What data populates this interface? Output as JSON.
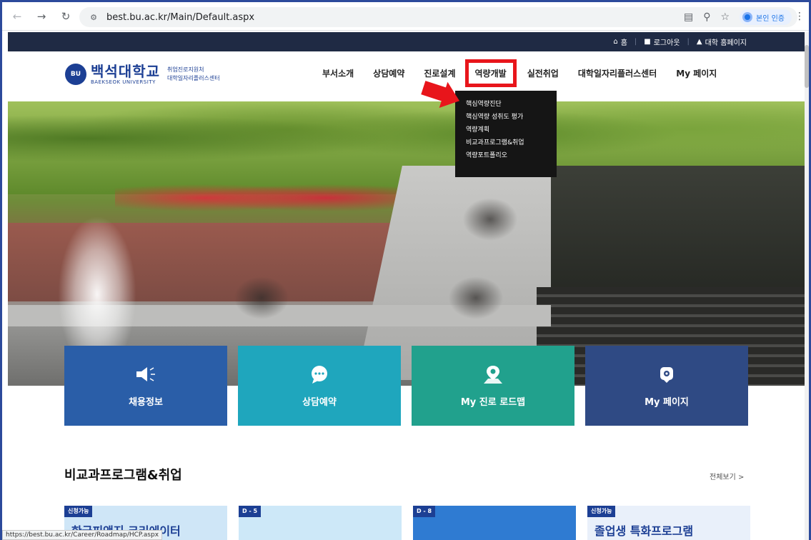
{
  "browser": {
    "url": "best.bu.ac.kr/Main/Default.aspx",
    "verify_label": "본인 인증",
    "status_url": "https://best.bu.ac.kr/Career/Roadmap/HCP.aspx"
  },
  "util_bar": {
    "home": "홈",
    "logout": "로그아웃",
    "univ_home": "대학 홈페이지"
  },
  "logo": {
    "mark": "BU",
    "name_kr": "백석대학교",
    "name_en": "BAEKSEOK UNIVERSITY",
    "sub1": "취업진로지원처",
    "sub2": "대학일자리플러스센터"
  },
  "gnb": [
    "부서소개",
    "상담예약",
    "진로설계",
    "역량개발",
    "실전취업",
    "대학일자리플러스센터",
    "My 페이지"
  ],
  "dropdown": [
    "핵심역량진단",
    "핵심역량 성취도 평가",
    "역량계획",
    "비교과프로그램&취업",
    "역량포트폴리오"
  ],
  "tiles": [
    {
      "label": "채용정보",
      "color": "#2a5ea8",
      "icon": "megaphone-icon"
    },
    {
      "label": "상담예약",
      "color": "#1fa6bd",
      "icon": "chat-bubble-icon"
    },
    {
      "label": "My 진로 로드맵",
      "color": "#21a18d",
      "icon": "map-pin-icon"
    },
    {
      "label": "My 페이지",
      "color": "#2f4a84",
      "icon": "gear-badge-icon"
    }
  ],
  "section": {
    "title": "비교과프로그램&취업",
    "view_all": "전체보기 >"
  },
  "cards": [
    {
      "badge": "신청가능",
      "text": "한국피앤지 크리에이터",
      "bg": "#cfe6f7"
    },
    {
      "badge": "D - 5",
      "text": "",
      "bg": "#cde8f8"
    },
    {
      "badge": "D - 8",
      "text": "",
      "bg": "#2f7bd2"
    },
    {
      "badge": "신청가능",
      "text": "졸업생 특화프로그램",
      "bg": "#e9f0fa"
    }
  ],
  "colors": {
    "accent": "#1c3f94",
    "highlight": "#e8151b"
  }
}
